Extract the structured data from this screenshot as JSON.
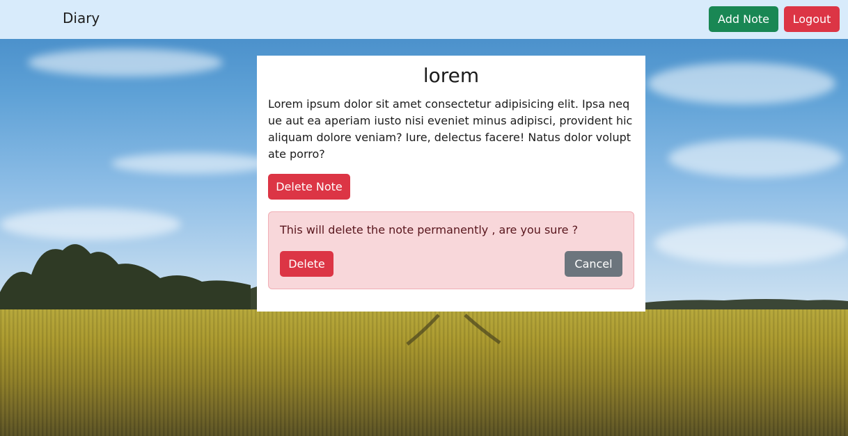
{
  "navbar": {
    "brand": "Diary",
    "add_note_label": "Add Note",
    "logout_label": "Logout"
  },
  "note": {
    "title": "lorem",
    "body": "Lorem ipsum dolor sit amet consectetur adipisicing elit. Ipsa neque aut ea aperiam iusto nisi eveniet minus adipisci, provident hic aliquam dolore veniam? Iure, delectus facere! Natus dolor voluptate porro?",
    "delete_note_label": "Delete Note"
  },
  "confirm": {
    "message": "This will delete the note permanently , are you sure ?",
    "delete_label": "Delete",
    "cancel_label": "Cancel"
  },
  "colors": {
    "navbar_bg": "#d8ebfb",
    "success": "#198754",
    "danger": "#dc3545",
    "secondary": "#6c757d",
    "alert_bg": "#f8d7da"
  }
}
